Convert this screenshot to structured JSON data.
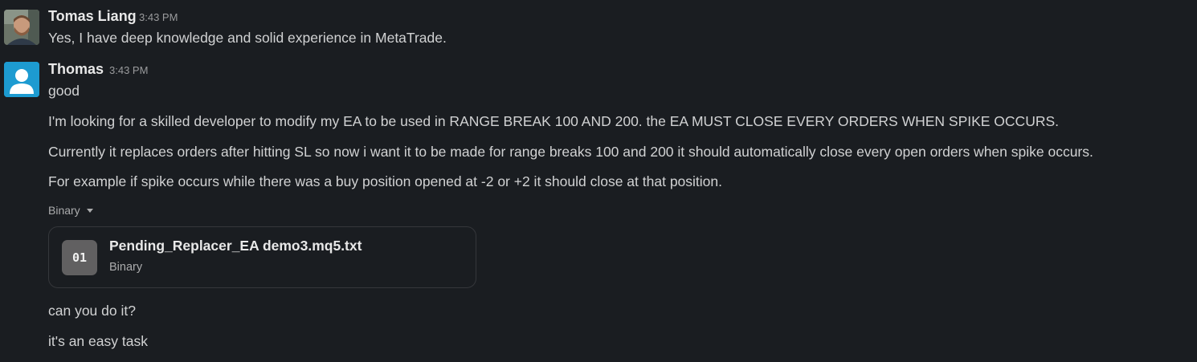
{
  "messages": [
    {
      "sender": "Tomas Liang",
      "time": "3:43 PM",
      "avatar": "user-photo-icon",
      "lines": [
        "Yes, I have deep knowledge and solid experience in MetaTrade."
      ]
    },
    {
      "sender": "Thomas",
      "time": "3:43 PM",
      "avatar": "default-user-icon",
      "lines": [
        "good",
        "I'm looking for a skilled developer to modify my EA to be used in RANGE BREAK 100 AND 200. the EA MUST CLOSE EVERY ORDERS WHEN SPIKE OCCURS.",
        "Currently it replaces orders after hitting SL so now i want it to be made for range breaks 100 and 200 it should automatically close every open orders when spike occurs.",
        "For example if spike occurs while there was a buy position opened at -2 or +2 it should close at that position."
      ],
      "attachment_toggle": "Binary",
      "attachment": {
        "icon_text": "01",
        "name": "Pending_Replacer_EA demo3.mq5.txt",
        "type": "Binary"
      },
      "followup_lines": [
        "can you do it?",
        "it's an easy task"
      ]
    }
  ],
  "colors": {
    "background": "#1a1d21",
    "text": "#d1d2d3",
    "muted": "#9a9b9d",
    "file_icon_bg": "#616061",
    "default_avatar_bg": "#1d9bd1"
  }
}
